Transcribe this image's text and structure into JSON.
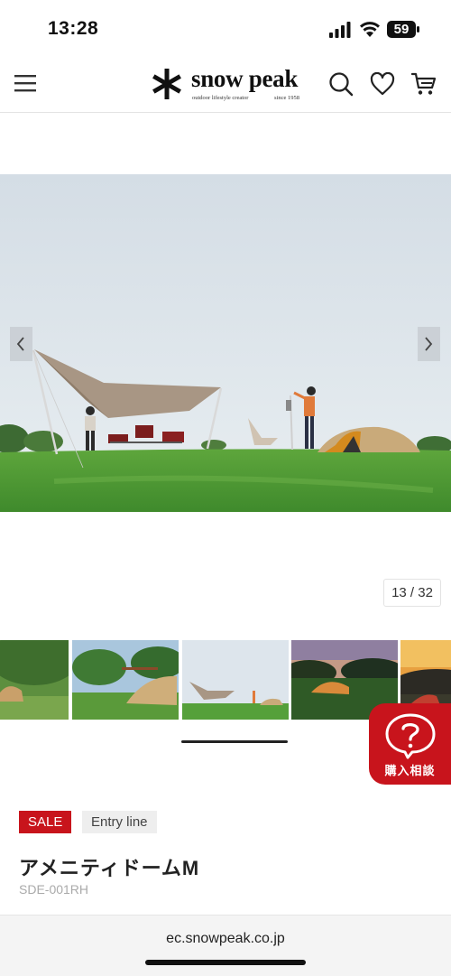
{
  "status": {
    "time": "13:28",
    "battery": "59"
  },
  "header": {
    "logo_text": "snow peak",
    "logo_tagline": "outdoor lifestyle creator",
    "logo_since": "since 1958"
  },
  "gallery": {
    "counter": "13 / 32",
    "current_index": 13,
    "total": 32
  },
  "consult": {
    "label": "購入相談"
  },
  "product": {
    "badges": {
      "sale": "SALE",
      "line": "Entry line"
    },
    "title": "アメニティドームM",
    "code": "SDE-001RH"
  },
  "browser": {
    "url": "ec.snowpeak.co.jp"
  },
  "colors": {
    "accent_red": "#c8141c",
    "sky": "#dfe6ec",
    "grass": "#4f9a35",
    "tarp": "#b09a84",
    "tent": "#c8a879"
  },
  "icons": [
    "signal-icon",
    "wifi-icon",
    "battery-icon",
    "menu-icon",
    "search-icon",
    "heart-icon",
    "cart-icon",
    "chevron-left-icon",
    "chevron-right-icon",
    "question-bubble-icon"
  ]
}
